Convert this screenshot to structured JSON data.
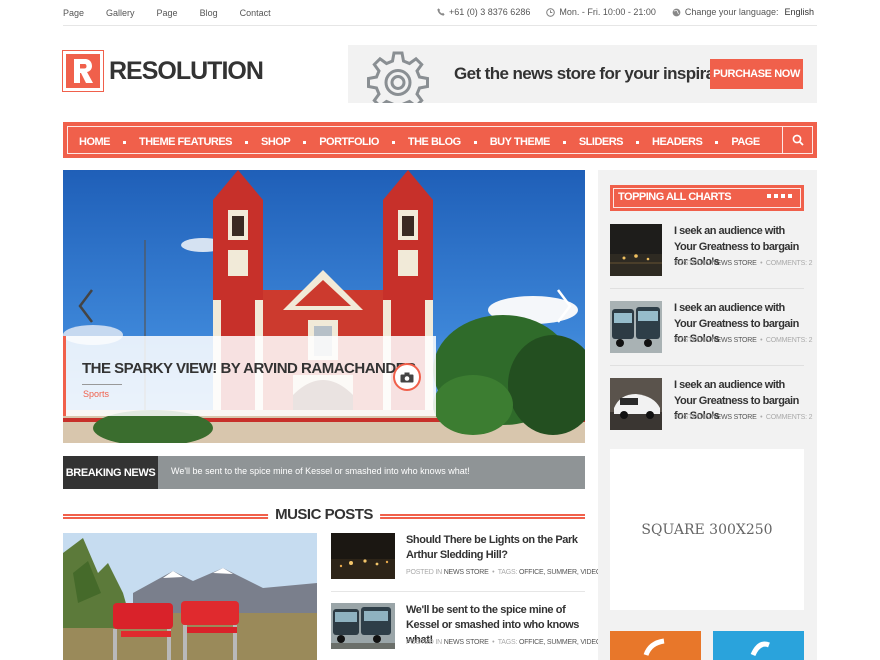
{
  "topbar": {
    "nav": [
      "Page",
      "Gallery",
      "Page",
      "Blog",
      "Contact"
    ],
    "phone": "+61 (0) 3 8376 6286",
    "hours": "Mon. - Fri. 10:00 - 21:00",
    "language_label": "Change your language:",
    "language_value": "English"
  },
  "brand": {
    "logo_letter": "R",
    "name": "RESOLUTION"
  },
  "banner": {
    "tagline": "Get the news store for your inspiration!",
    "button": "PURCHASE NOW"
  },
  "mainnav": {
    "items": [
      "HOME",
      "THEME FEATURES",
      "SHOP",
      "PORTFOLIO",
      "THE BLOG",
      "BUY THEME",
      "SLIDERS",
      "HEADERS",
      "PAGE"
    ]
  },
  "slider": {
    "title": "THE SPARKY VIEW! BY ARVIND RAMACHANDER",
    "category": "Sports"
  },
  "breaking": {
    "label": "BREAKING NEWS",
    "text": "We'll be sent to the spice mine of Kessel or smashed into who knows what!"
  },
  "music": {
    "section_title": "MUSIC POSTS",
    "posts": [
      {
        "title": "Should There be Lights on the Park Arthur Sledding Hill?",
        "posted_in": "POSTED IN",
        "category": "NEWS STORE",
        "tags_label": "TAGS:",
        "tags": "OFFICE, SUMMER, VIDEO"
      },
      {
        "title": "We'll be sent to the spice mine of Kessel or smashed into who knows what!",
        "posted_in": "POSTED IN",
        "category": "NEWS STORE",
        "tags_label": "TAGS:",
        "tags": "OFFICE, SUMMER, VIDEO"
      }
    ]
  },
  "sidebar": {
    "widget_title": "TOPPING ALL CHARTS",
    "posts": [
      {
        "title": "I seek an audience with Your Greatness to bargain for Solo's",
        "posted_in": "POSTED IN",
        "category": "NEWS STORE",
        "comments": "COMMENTS: 2"
      },
      {
        "title": "I seek an audience with Your Greatness to bargain for Solo's",
        "posted_in": "POSTED IN",
        "category": "NEWS STORE",
        "comments": "COMMENTS: 2"
      },
      {
        "title": "I seek an audience with Your Greatness to bargain for Solo's",
        "posted_in": "POSTED IN",
        "category": "NEWS STORE",
        "comments": "COMMENTS: 2"
      }
    ],
    "ad_label": "SQUARE 300X250"
  },
  "colors": {
    "accent": "#f0604b",
    "dark": "#333333",
    "breaking_bg": "#8f9496",
    "sidebar_bg": "#f2f2f2"
  }
}
